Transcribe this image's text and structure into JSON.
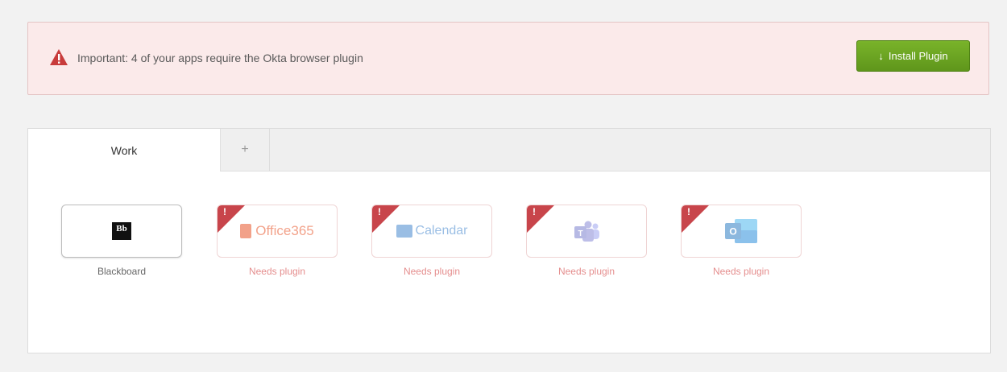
{
  "alert": {
    "message": "Important: 4 of your apps require the Okta browser plugin",
    "button_label": "Install Plugin",
    "button_icon": "download-arrow-icon",
    "arrow_glyph": "🡓"
  },
  "tabs": {
    "work_label": "Work",
    "add_label": "+"
  },
  "apps": [
    {
      "name": "Blackboard",
      "caption": "Blackboard",
      "logo_text": "Bb",
      "needs_plugin": false
    },
    {
      "name": "Office 365",
      "caption": "Needs plugin",
      "logo_text": "Office365",
      "needs_plugin": true
    },
    {
      "name": "Calendar",
      "caption": "Needs plugin",
      "logo_text": "Calendar",
      "needs_plugin": true
    },
    {
      "name": "Teams",
      "caption": "Needs plugin",
      "logo_text": "",
      "needs_plugin": true
    },
    {
      "name": "Outlook",
      "caption": "Needs plugin",
      "logo_text": "",
      "needs_plugin": true
    }
  ],
  "flag_glyph": "!",
  "colors": {
    "alert_bg": "#fbeaea",
    "button_green": "#6ba523",
    "flag_red": "#c8454b",
    "caption_pink": "#e58e8e"
  }
}
